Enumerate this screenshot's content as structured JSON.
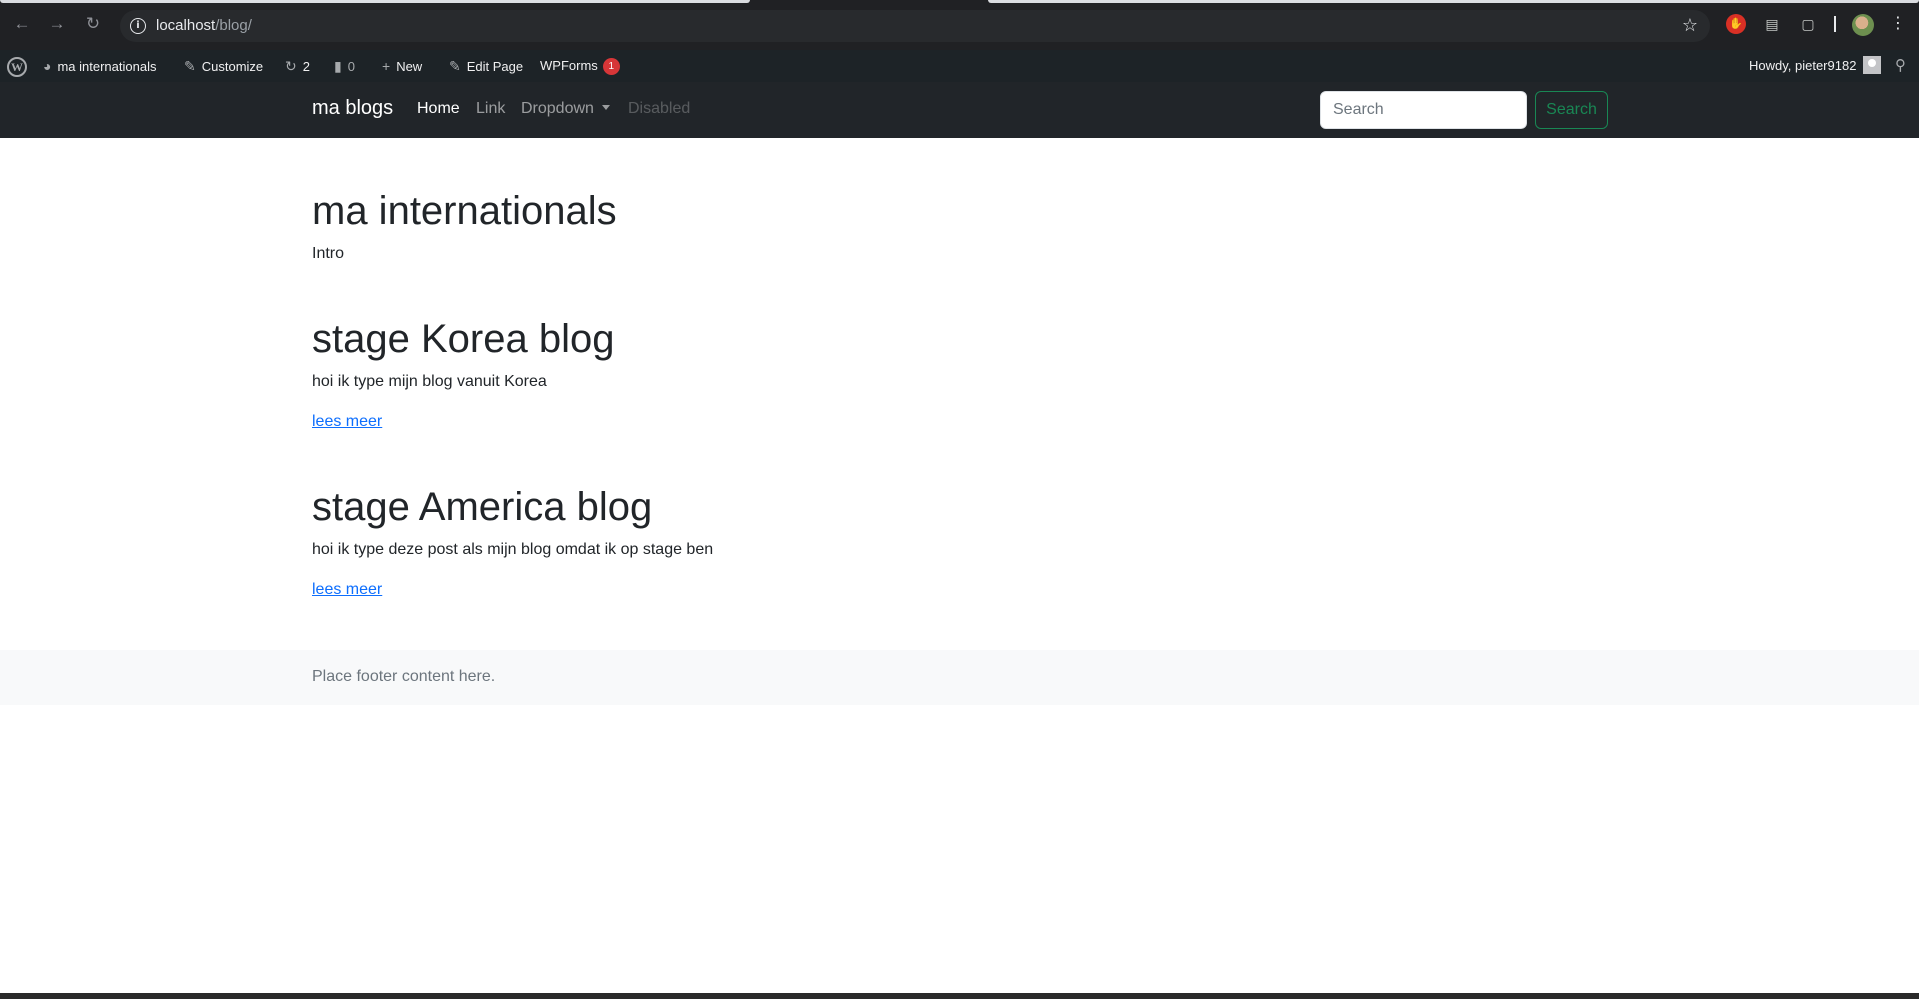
{
  "browser": {
    "url_host": "localhost",
    "url_path": "/blog/",
    "back_icon": "arrow-left-icon",
    "forward_icon": "arrow-right-icon",
    "reload_icon": "reload-icon"
  },
  "admin_bar": {
    "site_name": "ma internationals",
    "customize": "Customize",
    "updates_count": "2",
    "comments_count": "0",
    "new_label": "New",
    "edit_page": "Edit Page",
    "wpforms": "WPForms",
    "wpforms_badge": "1",
    "howdy": "Howdy, pieter9182"
  },
  "navbar": {
    "brand": "ma blogs",
    "links": [
      {
        "label": "Home",
        "state": "active"
      },
      {
        "label": "Link",
        "state": "normal"
      },
      {
        "label": "Dropdown",
        "state": "normal"
      },
      {
        "label": "Disabled",
        "state": "disabled"
      }
    ],
    "search_placeholder": "Search",
    "search_button": "Search"
  },
  "main": {
    "site_title": "ma internationals",
    "intro": "Intro",
    "posts": [
      {
        "title": "stage Korea blog",
        "excerpt": "hoi ik type mijn blog vanuit Korea",
        "link": "lees meer"
      },
      {
        "title": "stage America blog",
        "excerpt": "hoi ik type deze post als mijn blog omdat ik op stage ben",
        "link": "lees meer"
      }
    ]
  },
  "footer": {
    "text": "Place footer content here."
  },
  "colors": {
    "navbar_bg": "#212529",
    "admin_bar_bg": "#1d2327",
    "link": "#0d6efd",
    "success": "#198754",
    "badge": "#d63638"
  }
}
